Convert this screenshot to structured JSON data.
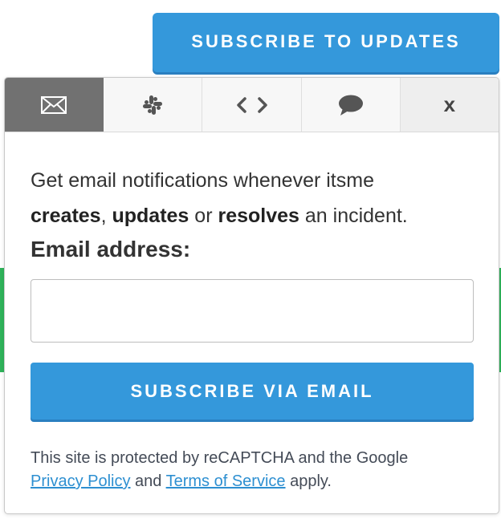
{
  "header": {
    "subscribe_button_label": "SUBSCRIBE TO UPDATES"
  },
  "tabs": [
    {
      "name": "email",
      "icon": "envelope-icon",
      "active": true
    },
    {
      "name": "slack",
      "icon": "slack-icon",
      "active": false
    },
    {
      "name": "webhook",
      "icon": "code-icon",
      "active": false
    },
    {
      "name": "chat",
      "icon": "speech-bubble-icon",
      "active": false
    },
    {
      "name": "close",
      "label": "x",
      "active": false
    }
  ],
  "email_panel": {
    "description_prefix": "Get email notifications whenever itsme",
    "bold_creates": "creates",
    "sep_comma": ", ",
    "bold_updates": "updates",
    "sep_or": " or ",
    "bold_resolves": "resolves",
    "suffix": " an incident.",
    "email_label": "Email address:",
    "email_value": "",
    "submit_label": "SUBSCRIBE VIA EMAIL",
    "legal_text": "This site is protected by reCAPTCHA and the Google",
    "privacy_link": "Privacy Policy",
    "legal_and": " and ",
    "terms_link": "Terms of Service",
    "legal_apply": " apply."
  },
  "colors": {
    "primary": "#3498db",
    "active_tab": "#717171",
    "link": "#2d8fd1",
    "status_green": "#2fb35a"
  }
}
